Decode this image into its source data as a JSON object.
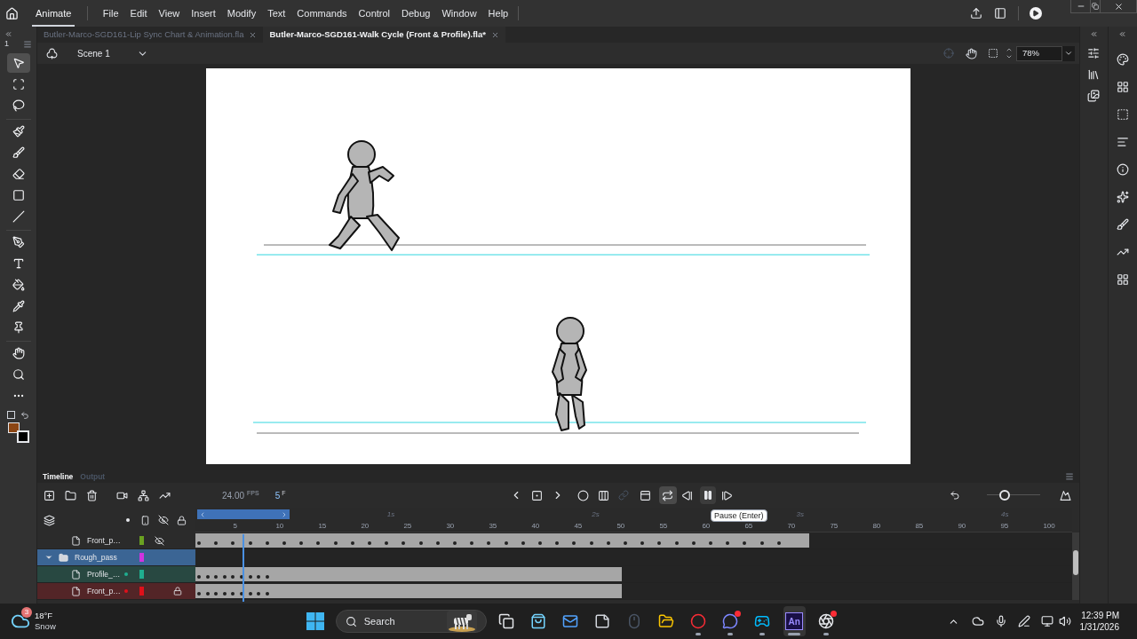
{
  "menu_bar": {
    "workspace": "Animate",
    "items": [
      "File",
      "Edit",
      "View",
      "Insert",
      "Modify",
      "Text",
      "Commands",
      "Control",
      "Debug",
      "Window",
      "Help"
    ]
  },
  "document_tabs": [
    {
      "label": "Butler-Marco-SGD161-Lip Sync Chart & Animation.fla",
      "selected": false
    },
    {
      "label": "Butler-Marco-SGD161-Walk Cycle (Front & Profile).fla*",
      "selected": true
    }
  ],
  "tools_panel": {
    "number": "1"
  },
  "tools": [
    {
      "kind": "selection",
      "selected": true
    },
    {
      "kind": "free-transform",
      "selected": false
    },
    {
      "kind": "lasso",
      "selected": false
    },
    {
      "kind": "paint-brush",
      "selected": false
    },
    {
      "kind": "brush",
      "selected": false
    },
    {
      "kind": "eraser",
      "selected": false
    },
    {
      "kind": "rectangle",
      "selected": false
    },
    {
      "kind": "line",
      "selected": false
    },
    {
      "kind": "pen",
      "selected": false
    },
    {
      "kind": "text",
      "selected": false
    },
    {
      "kind": "paint-bucket",
      "selected": false
    },
    {
      "kind": "eyedropper",
      "selected": false
    },
    {
      "kind": "pin",
      "selected": false
    },
    {
      "kind": "hand",
      "selected": false
    },
    {
      "kind": "zoom",
      "selected": false
    },
    {
      "kind": "more",
      "selected": false
    }
  ],
  "scene": "Scene 1",
  "zoom": "78%",
  "timeline": {
    "tabs": [
      {
        "label": "Timeline",
        "selected": true
      },
      {
        "label": "Output",
        "selected": false
      }
    ],
    "fps": "24.00",
    "fps_unit": "FPS",
    "frame_zoom": {
      "level": 0.3
    },
    "current_frame": "5",
    "frame_unit": "F",
    "loop_on": true,
    "playing": true,
    "tooltip": "Pause (Enter)",
    "time_marks": [
      "1s",
      "2s",
      "3s",
      "4s"
    ],
    "frame_numbers": [
      "5",
      "10",
      "15",
      "20",
      "25",
      "30",
      "35",
      "40",
      "45",
      "50",
      "55",
      "60",
      "65",
      "70",
      "75",
      "80",
      "85",
      "90",
      "95",
      "100"
    ],
    "layers": [
      {
        "name": "Front_p…",
        "kind": "layer",
        "color": "#6aa121",
        "hidden": true,
        "locked": false,
        "selected": false,
        "highlighted": false,
        "level": 0.7
      },
      {
        "name": "Rough_pass",
        "kind": "folder",
        "color": "#d033e0",
        "hidden": false,
        "locked": false,
        "selected": true,
        "expanded": true,
        "children": [
          {
            "name": "Profile_…",
            "kind": "layer",
            "color": "#1fae8f",
            "hidden": false,
            "locked": false,
            "selected": false,
            "highlighted": true
          },
          {
            "name": "Front_p…",
            "kind": "layer",
            "color": "#e0101a",
            "hidden": false,
            "locked": true,
            "selected": false,
            "highlighted": true
          }
        ]
      }
    ]
  },
  "taskbar": {
    "weather": {
      "badge": "3",
      "temperature": "18°F",
      "condition": "Snow"
    },
    "search": {
      "placeholder": "Search"
    },
    "apps": [
      {
        "kind": "task-view",
        "running": false,
        "notification": false
      },
      {
        "kind": "store",
        "running": false,
        "notification": false
      },
      {
        "kind": "mail",
        "running": false,
        "notification": false
      },
      {
        "kind": "notes",
        "running": false,
        "notification": false
      },
      {
        "kind": "mouse",
        "running": false,
        "notification": false
      },
      {
        "kind": "files",
        "running": false,
        "notification": false
      },
      {
        "kind": "opera",
        "running": true,
        "notification": false
      },
      {
        "kind": "discord",
        "running": true,
        "notification": true
      },
      {
        "kind": "steam",
        "running": true,
        "notification": false
      },
      {
        "kind": "animate",
        "label": "An",
        "running": true,
        "selected": true,
        "notification": false
      },
      {
        "kind": "obs",
        "running": true,
        "notification": true
      }
    ],
    "time": "12:39 PM",
    "date": "1/31/2026"
  }
}
